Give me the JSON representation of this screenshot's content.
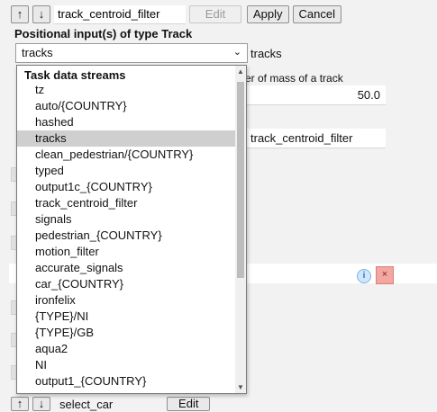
{
  "toolbar": {
    "up_label": "↑",
    "down_label": "↓",
    "name_value": "track_centroid_filter",
    "edit_label": "Edit",
    "apply_label": "Apply",
    "cancel_label": "Cancel"
  },
  "section": {
    "title": "Positional input(s) of type Track"
  },
  "select": {
    "value": "tracks",
    "right_value": "tracks"
  },
  "param": {
    "description": "er of mass of a track",
    "number_value": "50.0",
    "name_value": "track_centroid_filter"
  },
  "dropdown": {
    "group_label": "Task data streams",
    "selected_index": 3,
    "items": [
      "tz",
      "auto/{COUNTRY}",
      "hashed",
      "tracks",
      "clean_pedestrian/{COUNTRY}",
      "typed",
      "output1c_{COUNTRY}",
      "track_centroid_filter",
      "signals",
      "pedestrian_{COUNTRY}",
      "motion_filter",
      "accurate_signals",
      "car_{COUNTRY}",
      "ironfelix",
      "{TYPE}/NI",
      "{TYPE}/GB",
      "aqua2",
      "NI",
      "output1_{COUNTRY}"
    ]
  },
  "card": {
    "info_icon": "i",
    "close_icon": "×"
  },
  "bottom": {
    "up_label": "↑",
    "down_label": "↓",
    "name_value": "select_car",
    "edit_label": "Edit"
  },
  "colors": {
    "selected_bg": "#cfcfcf",
    "close_bg": "#f4a6a0",
    "info_bg": "#cfe6fb"
  }
}
